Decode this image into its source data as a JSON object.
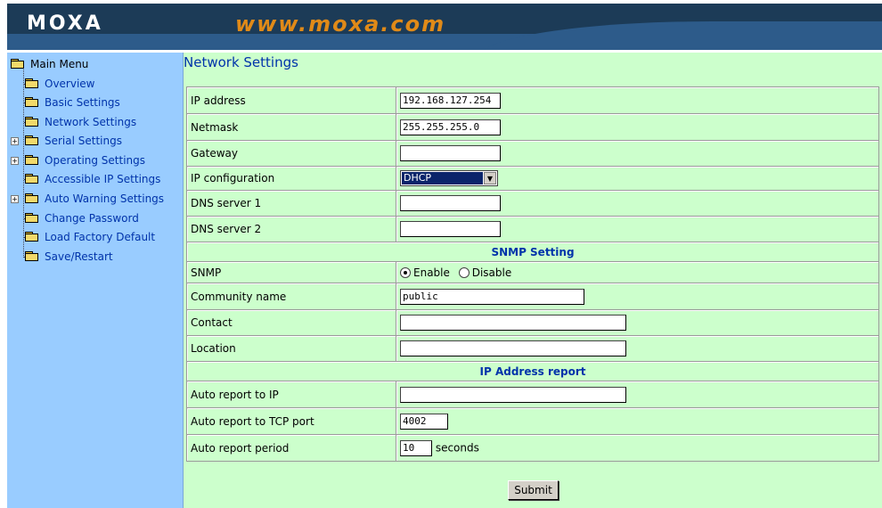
{
  "header": {
    "logo": "MOXA",
    "url": "www.moxa.com"
  },
  "sidebar": {
    "root": "Main Menu",
    "items": [
      {
        "label": "Overview",
        "expandable": false
      },
      {
        "label": "Basic Settings",
        "expandable": false
      },
      {
        "label": "Network Settings",
        "expandable": false
      },
      {
        "label": "Serial Settings",
        "expandable": true
      },
      {
        "label": "Operating Settings",
        "expandable": true
      },
      {
        "label": "Accessible IP Settings",
        "expandable": false
      },
      {
        "label": "Auto Warning Settings",
        "expandable": true
      },
      {
        "label": "Change Password",
        "expandable": false
      },
      {
        "label": "Load Factory Default",
        "expandable": false
      },
      {
        "label": "Save/Restart",
        "expandable": false
      }
    ]
  },
  "main": {
    "title": "Network Settings",
    "fields": {
      "ip_address": {
        "label": "IP address",
        "value": "192.168.127.254"
      },
      "netmask": {
        "label": "Netmask",
        "value": "255.255.255.0"
      },
      "gateway": {
        "label": "Gateway",
        "value": ""
      },
      "ip_configuration": {
        "label": "IP configuration",
        "value": "DHCP"
      },
      "dns1": {
        "label": "DNS server 1",
        "value": ""
      },
      "dns2": {
        "label": "DNS server 2",
        "value": ""
      }
    },
    "snmp_section": "SNMP Setting",
    "snmp": {
      "label": "SNMP",
      "enable_label": "Enable",
      "disable_label": "Disable",
      "selected": "Enable",
      "community": {
        "label": "Community name",
        "value": "public"
      },
      "contact": {
        "label": "Contact",
        "value": ""
      },
      "location": {
        "label": "Location",
        "value": ""
      }
    },
    "report_section": "IP Address report",
    "report": {
      "ip": {
        "label": "Auto report to IP",
        "value": ""
      },
      "tcp_port": {
        "label": "Auto report to TCP port",
        "value": "4002"
      },
      "period": {
        "label": "Auto report period",
        "value": "10",
        "unit": "seconds"
      }
    },
    "submit_label": "Submit"
  },
  "colors": {
    "sidebar_bg": "#99ccff",
    "main_bg": "#ccffcc",
    "header_dark": "#1c3b57",
    "header_mid": "#2d5b8a",
    "url_orange": "#e08a18",
    "link_blue": "#0033aa"
  }
}
